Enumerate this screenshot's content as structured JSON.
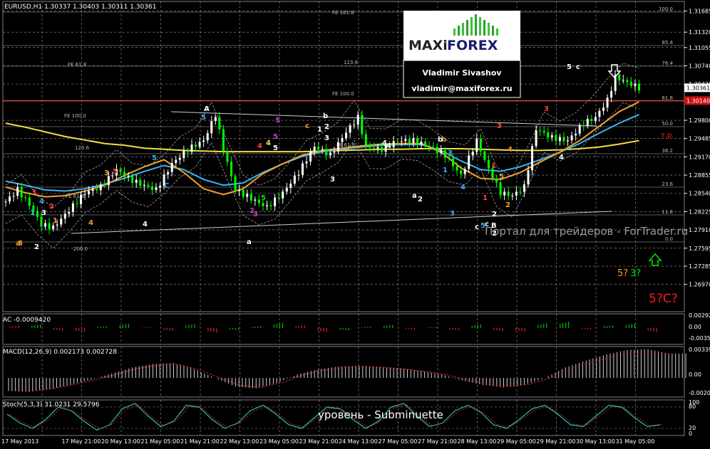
{
  "chart_data": {
    "type": "line",
    "symbol_header": "EURUSD,H1  1.30337 1.30403 1.30311 1.30361",
    "price_axis": {
      "ylim": [
        1.265,
        1.3185
      ],
      "ticks": [
        "1.31685",
        "1.31320",
        "1.31055",
        "1.30740",
        "1.30425",
        "1.29800",
        "1.29485",
        "1.29170",
        "1.28855",
        "1.28540",
        "1.28225",
        "1.27910",
        "1.27595",
        "1.27285",
        "1.26970"
      ],
      "current_price": "1.30361",
      "tp_price": "1.30140"
    },
    "time_axis": {
      "ticks": [
        "17 May 2013",
        "17 May 21:00",
        "20 May 13:00",
        "21 May 05:00",
        "21 May 21:00",
        "22 May 13:00",
        "23 May 05:00",
        "23 May 21:00",
        "24 May 13:00",
        "27 May 05:00",
        "27 May 21:00",
        "28 May 13:00",
        "29 May 05:00",
        "29 May 21:00",
        "30 May 13:00",
        "31 May 05:00"
      ]
    },
    "close_series": [
      {
        "t": 0,
        "v": 1.284
      },
      {
        "t": 3,
        "v": 1.286
      },
      {
        "t": 6,
        "v": 1.2835
      },
      {
        "t": 9,
        "v": 1.28
      },
      {
        "t": 12,
        "v": 1.2795
      },
      {
        "t": 16,
        "v": 1.2825
      },
      {
        "t": 20,
        "v": 1.2855
      },
      {
        "t": 24,
        "v": 1.2865
      },
      {
        "t": 28,
        "v": 1.2895
      },
      {
        "t": 31,
        "v": 1.288
      },
      {
        "t": 34,
        "v": 1.287
      },
      {
        "t": 38,
        "v": 1.286
      },
      {
        "t": 42,
        "v": 1.2905
      },
      {
        "t": 46,
        "v": 1.293
      },
      {
        "t": 50,
        "v": 1.2945
      },
      {
        "t": 53,
        "v": 1.299
      },
      {
        "t": 55,
        "v": 1.293
      },
      {
        "t": 58,
        "v": 1.286
      },
      {
        "t": 62,
        "v": 1.2845
      },
      {
        "t": 66,
        "v": 1.283
      },
      {
        "t": 70,
        "v": 1.2855
      },
      {
        "t": 74,
        "v": 1.289
      },
      {
        "t": 78,
        "v": 1.2935
      },
      {
        "t": 82,
        "v": 1.292
      },
      {
        "t": 86,
        "v": 1.296
      },
      {
        "t": 89,
        "v": 1.2985
      },
      {
        "t": 91,
        "v": 1.2935
      },
      {
        "t": 95,
        "v": 1.293
      },
      {
        "t": 99,
        "v": 1.2945
      },
      {
        "t": 103,
        "v": 1.2945
      },
      {
        "t": 107,
        "v": 1.2935
      },
      {
        "t": 111,
        "v": 1.292
      },
      {
        "t": 115,
        "v": 1.2885
      },
      {
        "t": 119,
        "v": 1.2945
      },
      {
        "t": 122,
        "v": 1.2895
      },
      {
        "t": 125,
        "v": 1.2855
      },
      {
        "t": 128,
        "v": 1.285
      },
      {
        "t": 131,
        "v": 1.2865
      },
      {
        "t": 134,
        "v": 1.2965
      },
      {
        "t": 138,
        "v": 1.295
      },
      {
        "t": 142,
        "v": 1.2945
      },
      {
        "t": 146,
        "v": 1.2975
      },
      {
        "t": 149,
        "v": 1.2985
      },
      {
        "t": 152,
        "v": 1.3015
      },
      {
        "t": 154,
        "v": 1.3055
      },
      {
        "t": 157,
        "v": 1.3045
      },
      {
        "t": 160,
        "v": 1.3036
      }
    ],
    "ma_series": [
      {
        "name": "",
        "color": "#f0e040",
        "values": [
          1.2975,
          1.2968,
          1.296,
          1.2952,
          1.2946,
          1.294,
          1.2937,
          1.2932,
          1.293,
          1.2928,
          1.2927,
          1.2926,
          1.2926,
          1.2926,
          1.2926,
          1.2926,
          1.2927,
          1.2928,
          1.2929,
          1.293,
          1.293,
          1.2931,
          1.2931,
          1.2931,
          1.293,
          1.2929,
          1.2928,
          1.2928,
          1.2929,
          1.2931,
          1.2934,
          1.2939,
          1.2945
        ]
      },
      {
        "name": "",
        "color": "#3ab4f2",
        "values": [
          1.2875,
          1.2868,
          1.286,
          1.2858,
          1.2862,
          1.287,
          1.288,
          1.2892,
          1.2902,
          1.2895,
          1.2878,
          1.2868,
          1.2872,
          1.289,
          1.2905,
          1.2918,
          1.2926,
          1.293,
          1.2934,
          1.2937,
          1.2938,
          1.2938,
          1.2928,
          1.291,
          1.2895,
          1.2892,
          1.29,
          1.2912,
          1.2925,
          1.294,
          1.2958,
          1.2975,
          1.299
        ]
      },
      {
        "name": "",
        "color": "#f0a030",
        "values": [
          1.2865,
          1.2855,
          1.2848,
          1.285,
          1.2858,
          1.2868,
          1.2885,
          1.29,
          1.2912,
          1.289,
          1.2862,
          1.2852,
          1.2862,
          1.2888,
          1.2905,
          1.292,
          1.2928,
          1.2932,
          1.2936,
          1.2939,
          1.294,
          1.294,
          1.2925,
          1.2898,
          1.288,
          1.2878,
          1.289,
          1.2908,
          1.2925,
          1.2945,
          1.297,
          1.2995,
          1.3012
        ]
      }
    ],
    "fib_labels": {
      "left": [
        "FE 61.8",
        "FE 100.0",
        "123.6",
        "FE 61.8",
        "200.0"
      ],
      "right": [
        "100.0",
        "85.4",
        "76.4",
        "61.8",
        "50.0",
        "38.2",
        "23.6",
        "11.8",
        "0.0"
      ],
      "center": [
        "FE 161.8",
        "123.6",
        "FE 100.0",
        "FE 61.8"
      ]
    },
    "wave_labels": [
      "A",
      "5",
      "b",
      "c",
      "2",
      "1",
      "3",
      "5",
      "4",
      "5",
      "a",
      "b",
      "3",
      "4",
      "1",
      "2",
      "3",
      "4",
      "5",
      "a",
      "b",
      "c",
      "2",
      "3",
      "4",
      "1",
      "2",
      "3",
      "4",
      "5",
      "c",
      "5",
      "c",
      "B",
      "1",
      "2",
      "3",
      "4",
      "5",
      "C",
      "4",
      "3",
      "5",
      "2",
      "1",
      "4",
      "5",
      "a",
      "3",
      "1",
      "2",
      "4",
      "5",
      "3",
      "5",
      "2",
      "3",
      "4"
    ],
    "forecast": {
      "label_a": "5?",
      "label_b": "3?",
      "label_c": "5?C?"
    },
    "tp_label": "т.р.",
    "watermark": "Портал для трейдеров - ForTrader.ru",
    "bottom_caption": "уровень - Subminuette",
    "logo": {
      "maxi": "MAXi",
      "forex": "FOREX",
      "name": "Vladimir Sivashov",
      "email": "vladimir@maxiforex.ru"
    },
    "ac": {
      "label": "AC -0.0009420",
      "ticks": [
        "0.00292",
        "0.00",
        "-0.00352"
      ],
      "values": [
        0.0005,
        0.0008,
        -0.0006,
        -0.0009,
        0.0004,
        0.001,
        0.0002,
        -0.0007,
        0.0009,
        -0.0011,
        -0.0005,
        0.0004,
        0.0012,
        0.0006,
        -0.001,
        -0.0006,
        0.0003,
        0.0007,
        -0.0004,
        0.0002,
        -0.0006,
        0.0008,
        -0.0007,
        -0.0009,
        0.0011,
        0.0015,
        -0.0004,
        0.0006,
        0.001,
        -0.0009
      ],
      "ylim": [
        -0.0035,
        0.003
      ]
    },
    "macd": {
      "label": "MACD(12,26,9) 0.002173 0.002728",
      "ticks": [
        "0.003397",
        "0.00",
        "-0.002030"
      ],
      "values": [
        -0.0015,
        -0.0016,
        -0.0013,
        -0.0008,
        -0.0002,
        0.0005,
        0.0012,
        0.0016,
        0.0017,
        0.001,
        0.0,
        -0.001,
        -0.0012,
        -0.0006,
        0.0004,
        0.001,
        0.0013,
        0.0014,
        0.0013,
        0.0011,
        0.0008,
        0.0004,
        -0.0003,
        -0.0008,
        -0.0011,
        -0.0008,
        0.0,
        0.0012,
        0.002,
        0.0027,
        0.0032,
        0.0033,
        0.0028
      ],
      "ylim": [
        -0.0022,
        0.0036
      ]
    },
    "stoch": {
      "label": "Stoch(5,3,3) 31.0231 29.5796",
      "ticks": [
        "100",
        "80",
        "20",
        "0"
      ],
      "values": [
        60,
        35,
        20,
        45,
        80,
        70,
        40,
        15,
        30,
        75,
        90,
        55,
        25,
        40,
        85,
        80,
        45,
        20,
        35,
        70,
        85,
        60,
        30,
        20,
        50,
        80,
        75,
        45,
        20,
        40,
        80,
        90,
        55,
        25,
        35,
        70,
        85,
        65,
        30,
        20,
        45,
        75,
        85,
        60,
        30,
        25,
        55,
        85,
        80,
        50,
        25,
        30
      ]
    },
    "colors": {
      "up": "#ffffff",
      "down": "#00ff00",
      "grid": "#c8c8c8",
      "tp_line": "#ff2020"
    }
  }
}
